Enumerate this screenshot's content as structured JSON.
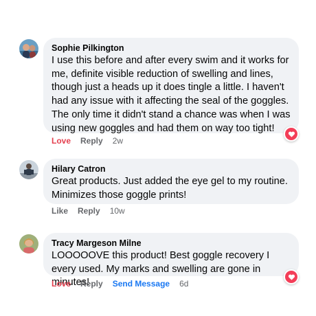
{
  "comments": [
    {
      "author": "Sophie Pilkington",
      "text": "I use this before and after every swim and it works for me, definite visible reduction of swelling and lines, though just a heads up it does tingle a little. I haven't had any issue with it affecting the seal of the goggles. The only time it didn't stand a chance was when I was using new goggles and had them on way too tight!",
      "actions": {
        "reaction": "Love",
        "reply": "Reply",
        "time": "2w"
      },
      "has_reaction_badge": true
    },
    {
      "author": "Hilary Catron",
      "text": "Great products. Just added the eye gel to my routine. Minimizes those goggle prints!",
      "actions": {
        "reaction": "Like",
        "reply": "Reply",
        "time": "10w"
      },
      "has_reaction_badge": false
    },
    {
      "author": "Tracy Margeson Milne",
      "text": "LOOOOOVE this product! Best goggle recovery I every used. My marks and swelling are gone in minutes!",
      "actions": {
        "reaction": "Love",
        "reply": "Reply",
        "send_message": "Send Message",
        "time": "6d"
      },
      "has_reaction_badge": true
    }
  ],
  "icons": {
    "reaction_badge": "heart-icon"
  },
  "colors": {
    "bubble": "#f0f2f5",
    "love": "#e4404f",
    "link": "#1877f2",
    "muted": "#65676b",
    "heart_badge": "#f33e58"
  }
}
